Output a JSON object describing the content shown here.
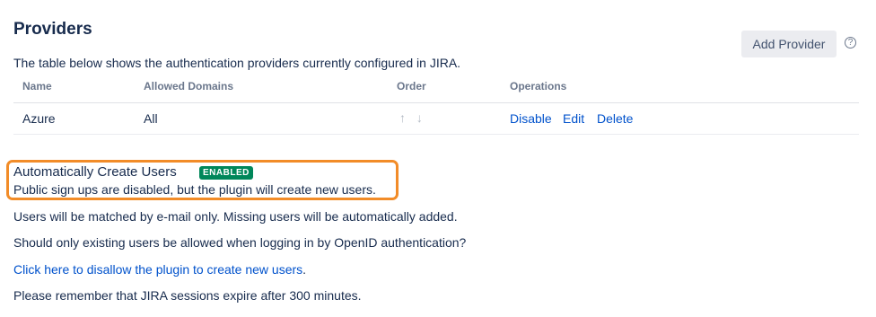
{
  "providers": {
    "title": "Providers",
    "add_button": "Add Provider",
    "help_icon": "?",
    "description": "The table below shows the authentication providers currently configured in JIRA.",
    "columns": [
      "Name",
      "Allowed Domains",
      "Order",
      "Operations"
    ],
    "rows": [
      {
        "name": "Azure",
        "allowed_domains": "All",
        "order_icons": "↑ ↓",
        "operations": [
          "Disable",
          "Edit",
          "Delete"
        ]
      }
    ]
  },
  "auto_create": {
    "title": "Automatically Create Users",
    "status_badge": "ENABLED",
    "status_detail": "Public sign ups are disabled, but the plugin will create new users.",
    "matching_note": "Users will be matched by e-mail only. Missing users will be automatically added.",
    "question": "Should only existing users be allowed when logging in by OpenID authentication?",
    "toggle_link": "Click here to disallow the plugin to create new users",
    "toggle_link_suffix": ".",
    "session_note": "Please remember that JIRA sessions expire after 300 minutes."
  },
  "colors": {
    "link": "#0052cc",
    "badge_bg": "#00875a",
    "highlight_border": "#f28c28"
  }
}
